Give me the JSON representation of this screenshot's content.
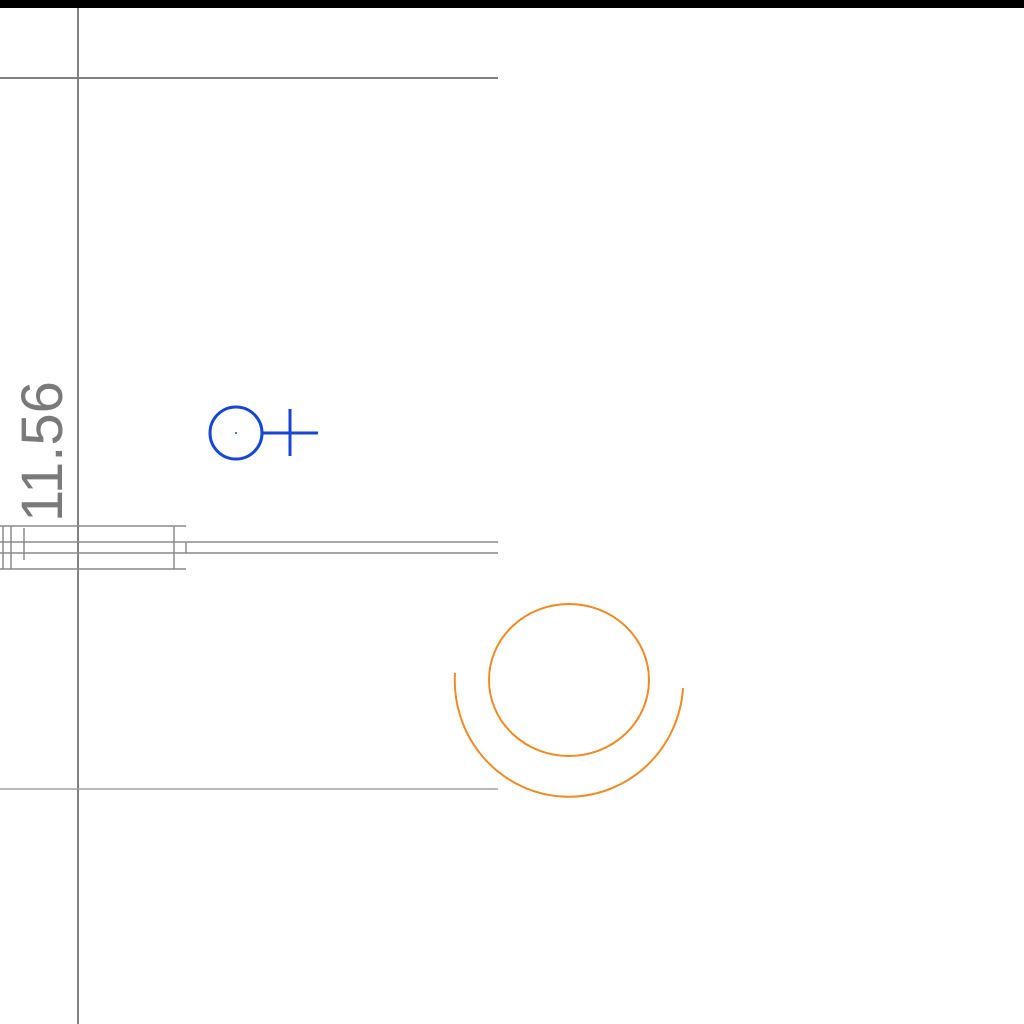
{
  "drawing": {
    "dimension_label": "11.56",
    "symbols": [
      {
        "name": "level-marker-icon",
        "color": "#1646d6"
      },
      {
        "name": "ring-arc-icon",
        "color": "#f08a24"
      }
    ],
    "colors": {
      "grid_line": "#808080",
      "wall_line": "#8a8a8a",
      "dimension_text": "#7a7a7a",
      "top_bar": "#000000"
    }
  }
}
